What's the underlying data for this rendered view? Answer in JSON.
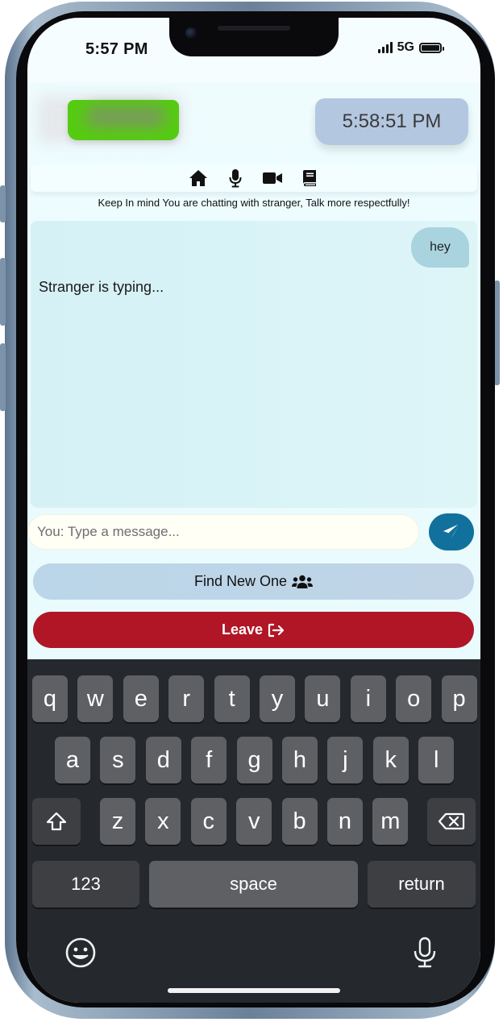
{
  "status_bar": {
    "time": "5:57 PM",
    "network": "5G"
  },
  "header": {
    "clock": "5:58:51 PM"
  },
  "nav": {
    "icons": [
      "home-icon",
      "microphone-icon",
      "video-camera-icon",
      "book-icon"
    ]
  },
  "notice": "Keep In mind You are chatting with stranger, Talk more respectfully!",
  "chat": {
    "messages": [
      {
        "from": "you",
        "text": "hey"
      }
    ],
    "typing_indicator": "Stranger is typing..."
  },
  "composer": {
    "placeholder": "You: Type a message...",
    "value": ""
  },
  "actions": {
    "find_new": "Find New One",
    "leave": "Leave"
  },
  "keyboard": {
    "row1": [
      "q",
      "w",
      "e",
      "r",
      "t",
      "y",
      "u",
      "i",
      "o",
      "p"
    ],
    "row2": [
      "a",
      "s",
      "d",
      "f",
      "g",
      "h",
      "j",
      "k",
      "l"
    ],
    "row3": [
      "z",
      "x",
      "c",
      "v",
      "b",
      "n",
      "m"
    ],
    "numbers_key": "123",
    "space_key": "space",
    "return_key": "return"
  },
  "colors": {
    "send_button": "#11719c",
    "leave_button": "#b01626",
    "find_button": "#bbd6e9",
    "chat_panel": "#d8f3f7",
    "clock_box": "#b4c7e1"
  }
}
